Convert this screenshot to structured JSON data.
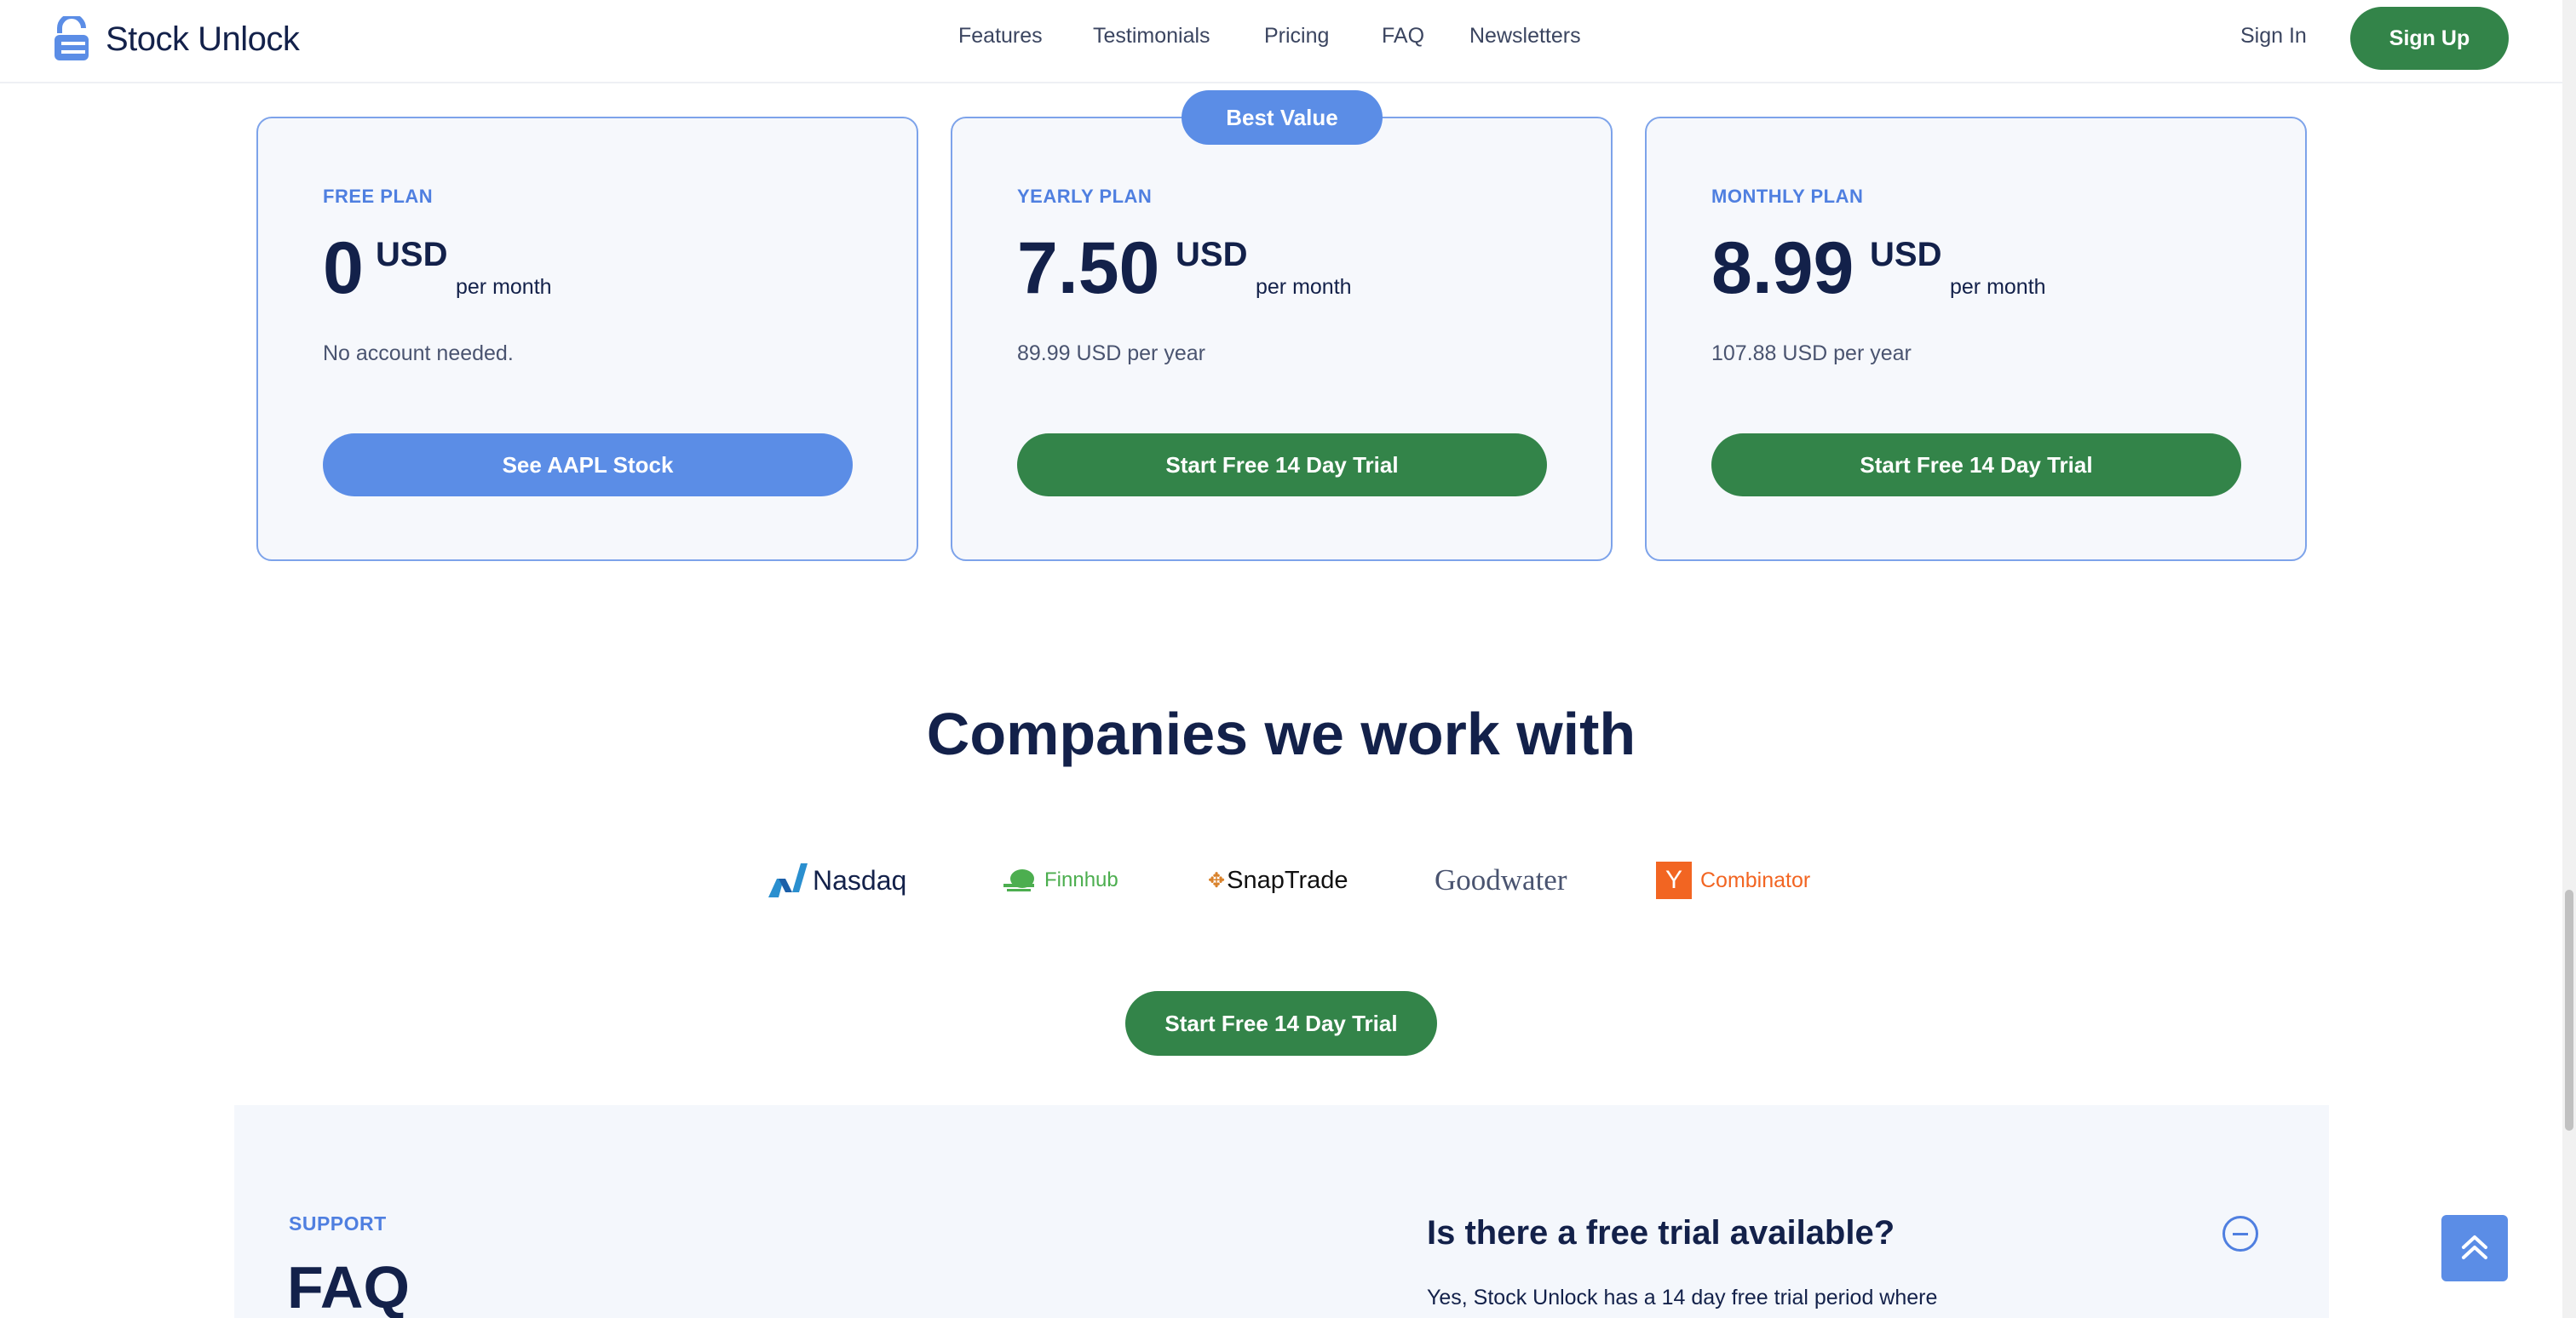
{
  "header": {
    "brand": "Stock Unlock",
    "nav": [
      "Features",
      "Testimonials",
      "Pricing",
      "FAQ",
      "Newsletters"
    ],
    "sign_in": "Sign In",
    "sign_up": "Sign Up"
  },
  "pricing": {
    "badge": "Best Value",
    "plans": [
      {
        "label": "FREE PLAN",
        "price": "0",
        "currency": "USD",
        "period": "per month",
        "note": "No account needed.",
        "cta": "See AAPL Stock"
      },
      {
        "label": "YEARLY PLAN",
        "price": "7.50",
        "currency": "USD",
        "period": "per month",
        "note": "89.99 USD per year",
        "cta": "Start Free 14 Day Trial"
      },
      {
        "label": "MONTHLY PLAN",
        "price": "8.99",
        "currency": "USD",
        "period": "per month",
        "note": "107.88 USD per year",
        "cta": "Start Free 14 Day Trial"
      }
    ]
  },
  "companies": {
    "title": "Companies we work with",
    "logos": [
      "Nasdaq",
      "Finnhub",
      "SnapTrade",
      "Goodwater",
      "Y",
      "Combinator"
    ],
    "cta": "Start Free 14 Day Trial"
  },
  "faq": {
    "kicker": "SUPPORT",
    "title": "FAQ",
    "question": "Is there a free trial available?",
    "answer": "Yes, Stock Unlock has a 14 day free trial period where"
  },
  "colors": {
    "primary_green": "#338449",
    "accent_blue": "#5b8de6",
    "navy": "#13214a"
  },
  "icons": [
    "stock-unlock-logo-icon",
    "faq-collapse-icon",
    "scroll-to-top-icon"
  ]
}
